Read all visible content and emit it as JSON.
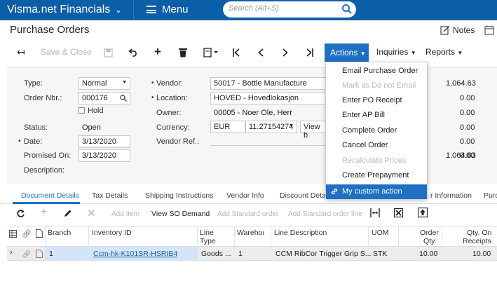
{
  "header": {
    "brand": "Visma.net Financials",
    "menu_label": "Menu",
    "search_placeholder": "Search (Alt+S)"
  },
  "page": {
    "title": "Purchase Orders",
    "notes_label": "Notes"
  },
  "toolbar": {
    "save_close": "Save & Close",
    "actions": "Actions",
    "inquiries": "Inquiries",
    "reports": "Reports"
  },
  "form": {
    "type_label": "Type:",
    "type_value": "Normal",
    "order_nbr_label": "Order Nbr.:",
    "order_nbr_value": "000176",
    "hold_label": "Hold",
    "status_label": "Status:",
    "status_value": "Open",
    "date_label": "Date:",
    "date_value": "3/13/2020",
    "promised_label": "Promised On:",
    "promised_value": "3/13/2020",
    "description_label": "Description:",
    "vendor_label": "Vendor:",
    "vendor_value": "50017 - Bottle Manufacture",
    "location_label": "Location:",
    "location_value": "HOVED - Hovedlokasjon",
    "owner_label": "Owner:",
    "owner_value": "00005 - Noer Ole, Herr",
    "currency_label": "Currency:",
    "currency_value": "EUR",
    "rate_value": "11.27154274",
    "view_button": "View b",
    "vendor_ref_label": "Vendor Ref.:",
    "totals": [
      "1,064.63",
      "0.00",
      "0.00",
      "0.00",
      "0.00",
      "0.00",
      "1,064.63"
    ]
  },
  "tabs": [
    "Document Details",
    "Tax Details",
    "Shipping Instructions",
    "Vendor Info",
    "Discount Detail",
    "r Information",
    "Purc"
  ],
  "grid_toolbar": {
    "add_item": "Add Item",
    "view_so_demand": "View SO Demand",
    "add_standard_order": "Add Standard order",
    "add_standard_order_line": "Add Standard order line"
  },
  "grid": {
    "headers": {
      "branch": "Branch",
      "inventory_id": "Inventory ID",
      "line_type_1": "Line",
      "line_type_2": "Type",
      "warehouse": "Warehoı",
      "line_description": "Line Description",
      "uom": "UOM",
      "order_qty_1": "Order",
      "order_qty_2": "Qty.",
      "qty_receipts_1": "Qty. On",
      "qty_receipts_2": "Receipts"
    },
    "rows": [
      {
        "branch": "1",
        "inventory_id": "Ccm-hk-K101SR-HSRIB4",
        "line_type": "Goods ...",
        "warehouse": "1",
        "line_description": "CCM RibCor Trigger Grip S...",
        "uom": "STK",
        "order_qty": "10.00",
        "qty_on_receipts": "10.00"
      }
    ]
  },
  "actions_menu": [
    {
      "label": "Email Purchase Order",
      "disabled": false
    },
    {
      "label": "Mark as Do not Email",
      "disabled": true
    },
    {
      "label": "Enter PO Receipt",
      "disabled": false
    },
    {
      "label": "Enter AP Bill",
      "disabled": false
    },
    {
      "label": "Complete Order",
      "disabled": false
    },
    {
      "label": "Cancel Order",
      "disabled": false
    },
    {
      "label": "Recalculate Prices",
      "disabled": true
    },
    {
      "label": "Create Prepayment",
      "disabled": false
    },
    {
      "label": "My custom action",
      "disabled": false,
      "highlighted": true
    }
  ],
  "colors": {
    "topbar": "#0b5ea8",
    "accent": "#1f6fc4"
  }
}
